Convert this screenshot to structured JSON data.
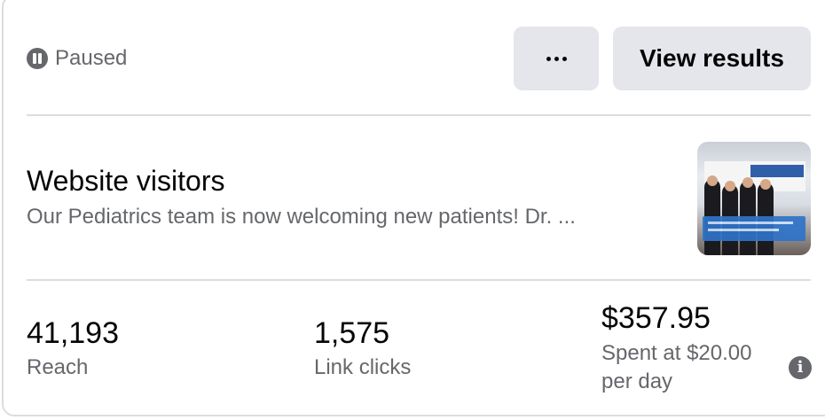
{
  "status": {
    "label": "Paused",
    "icon": "pause-circle-icon"
  },
  "toolbar": {
    "more_icon": "ellipsis-icon",
    "view_results_label": "View results"
  },
  "ad": {
    "objective": "Website visitors",
    "primary_text": "Our Pediatrics team is now welcoming new patients! Dr. ..."
  },
  "metrics": [
    {
      "value": "41,193",
      "label": "Reach"
    },
    {
      "value": "1,575",
      "label": "Link clicks"
    },
    {
      "value": "$357.95",
      "label": "Spent at $20.00 per day"
    }
  ],
  "colors": {
    "button_bg": "#e4e6eb",
    "secondary_text": "#65676b",
    "primary_text": "#050505",
    "divider": "#dadde1"
  }
}
